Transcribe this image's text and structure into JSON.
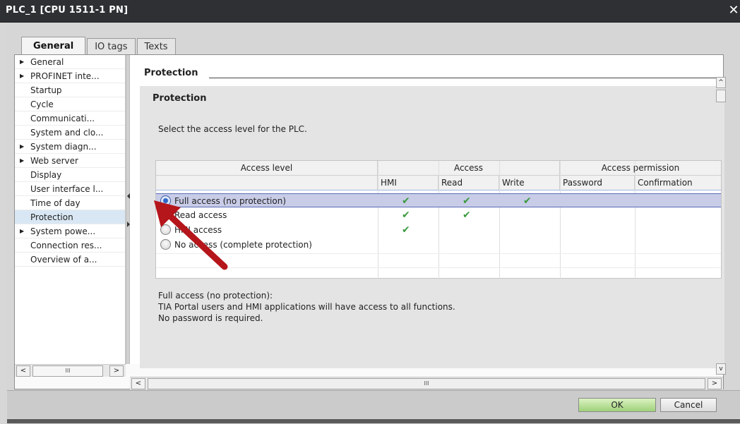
{
  "window": {
    "title": "PLC_1 [CPU 1511-1 PN]",
    "close_glyph": "✕"
  },
  "tabs": [
    {
      "label": "General",
      "active": true
    },
    {
      "label": "IO tags",
      "active": false
    },
    {
      "label": "Texts",
      "active": false
    }
  ],
  "nav": {
    "items": [
      {
        "label": "General",
        "expandable": true
      },
      {
        "label": "PROFINET inte...",
        "expandable": true
      },
      {
        "label": "Startup",
        "expandable": false
      },
      {
        "label": "Cycle",
        "expandable": false
      },
      {
        "label": "Communicati...",
        "expandable": false
      },
      {
        "label": "System and clo...",
        "expandable": false
      },
      {
        "label": "System diagn...",
        "expandable": true
      },
      {
        "label": "Web server",
        "expandable": true
      },
      {
        "label": "Display",
        "expandable": false
      },
      {
        "label": "User interface l...",
        "expandable": false
      },
      {
        "label": "Time of day",
        "expandable": false
      },
      {
        "label": "Protection",
        "expandable": false,
        "selected": true
      },
      {
        "label": "System powe...",
        "expandable": true
      },
      {
        "label": "Connection res...",
        "expandable": false
      },
      {
        "label": "Overview of a...",
        "expandable": false
      }
    ],
    "scroll_left": "<",
    "scroll_right": ">",
    "scroll_thumb": "III"
  },
  "content": {
    "section_title": "Protection",
    "panel_title": "Protection",
    "instruction": "Select the access level for the PLC.",
    "scroll_left": "<",
    "scroll_right": ">",
    "scroll_thumb": "III",
    "scroll_up": "^",
    "scroll_down": "v"
  },
  "table": {
    "group_headers": {
      "access_level": "Access level",
      "access": "Access",
      "permission": "Access permission"
    },
    "sub_headers": {
      "hmi": "HMI",
      "read": "Read",
      "write": "Write",
      "password": "Password",
      "confirmation": "Confirmation"
    },
    "rows": [
      {
        "label": "Full access (no protection)",
        "selected": true,
        "hmi": "✔",
        "read": "✔",
        "write": "✔"
      },
      {
        "label": "Read access",
        "selected": false,
        "hmi": "✔",
        "read": "✔",
        "write": ""
      },
      {
        "label": "HMI access",
        "selected": false,
        "hmi": "✔",
        "read": "",
        "write": ""
      },
      {
        "label": "No access (complete protection)",
        "selected": false,
        "hmi": "",
        "read": "",
        "write": ""
      }
    ]
  },
  "description": {
    "line1": "Full access (no protection):",
    "line2": "TIA Portal users and HMI applications will have access to all functions.",
    "line3": "No password is required."
  },
  "buttons": {
    "ok": "OK",
    "cancel": "Cancel"
  },
  "colors": {
    "accent": "#3b9a3f",
    "arrow": "#b5161b",
    "selection": "#c8cce7"
  }
}
